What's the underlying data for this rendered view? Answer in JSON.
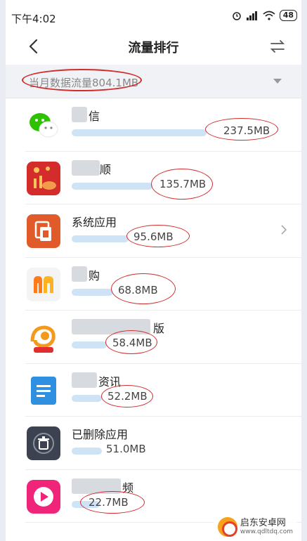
{
  "status": {
    "time": "下午4:02",
    "battery": "48",
    "icons": [
      "alarm-icon",
      "signal-icon",
      "wifi-icon",
      "battery-icon"
    ]
  },
  "header": {
    "title": "流量排行",
    "back_icon": "chevron-left-icon",
    "swap_icon": "swap-icon"
  },
  "summary": {
    "label": "当月数据流量804.1MB"
  },
  "apps": [
    {
      "name": "信",
      "usage": "237.5MB",
      "fraction": 0.62,
      "icon": "wechat-icon",
      "color": "#2dc100"
    },
    {
      "name": "顺",
      "usage": "135.7MB",
      "fraction": 0.37,
      "icon": "finance-app-icon",
      "color": "#d42b2b"
    },
    {
      "name": "系统应用",
      "usage": "95.6MB",
      "fraction": 0.26,
      "icon": "system-app-icon",
      "color": "#e15b2a"
    },
    {
      "name": "购",
      "usage": "68.8MB",
      "fraction": 0.19,
      "icon": "shopping-app-icon",
      "color": "#ff7a1a"
    },
    {
      "name": "版",
      "usage": "58.4MB",
      "fraction": 0.16,
      "icon": "uc-browser-icon",
      "color": "#f39a1e"
    },
    {
      "name": "资讯",
      "usage": "52.2MB",
      "fraction": 0.14,
      "icon": "news-app-icon",
      "color": "#2f8fe0"
    },
    {
      "name": "已删除应用",
      "usage": "51.0MB",
      "fraction": 0.14,
      "icon": "trash-icon",
      "color": "#3c4250"
    },
    {
      "name": "频",
      "usage": "22.7MB",
      "fraction": 0.06,
      "icon": "video-app-icon",
      "color": "#f0257a"
    }
  ],
  "watermark": {
    "name": "启东安卓网",
    "url": "www.qdltdq.com"
  }
}
